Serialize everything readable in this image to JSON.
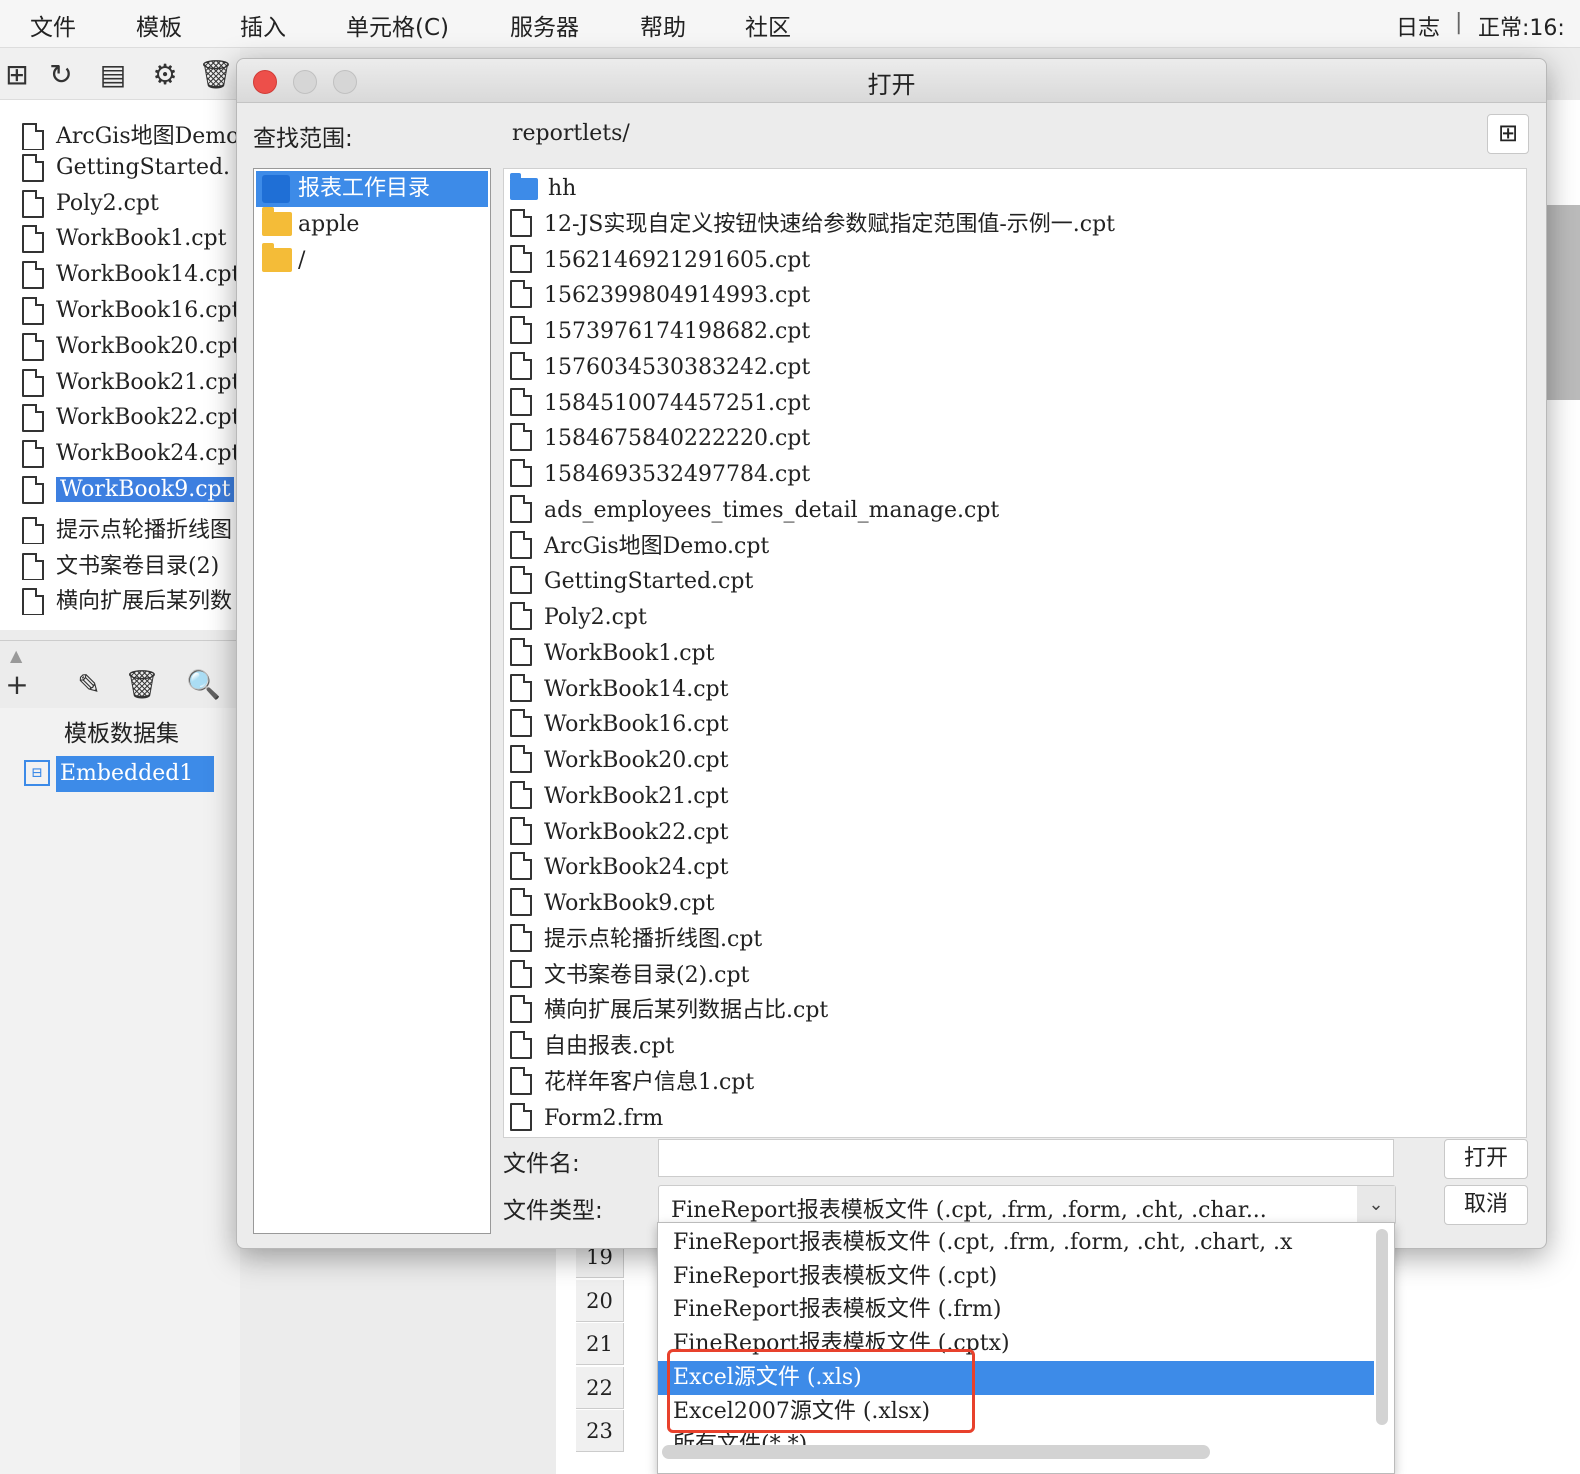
{
  "menubar": {
    "items": [
      "文件",
      "模板",
      "插入",
      "单元格(C)",
      "服务器",
      "帮助",
      "社区"
    ],
    "log_label": "日志",
    "separator": "|",
    "status_text": "正常:16:"
  },
  "left_tree": {
    "files": [
      "ArcGis地图Demo.",
      "GettingStarted.",
      "Poly2.cpt",
      "WorkBook1.cpt",
      "WorkBook14.cpt",
      "WorkBook16.cpt",
      "WorkBook20.cpt",
      "WorkBook21.cpt",
      "WorkBook22.cpt",
      "WorkBook24.cpt",
      "WorkBook9.cpt",
      "提示点轮播折线图",
      "文书案卷目录(2)",
      "横向扩展后某列数"
    ],
    "selected_index": 10
  },
  "dataset_panel": {
    "title": "模板数据集",
    "items": [
      "Embedded1"
    ]
  },
  "spreadsheet": {
    "row_numbers": [
      "19",
      "20",
      "21",
      "22",
      "23"
    ]
  },
  "dialog": {
    "title": "打开",
    "lookin_label": "查找范围:",
    "lookin_path": "reportlets/",
    "places": [
      "报表工作目录",
      "apple",
      "/"
    ],
    "selected_place": 0,
    "folders": [
      "hh"
    ],
    "files": [
      "12-JS实现自定义按钮快速给参数赋指定范围值-示例一.cpt",
      "1562146921291605.cpt",
      "1562399804914993.cpt",
      "1573976174198682.cpt",
      "1576034530383242.cpt",
      "1584510074457251.cpt",
      "1584675840222220.cpt",
      "1584693532497784.cpt",
      "ads_employees_times_detail_manage.cpt",
      "ArcGis地图Demo.cpt",
      "GettingStarted.cpt",
      "Poly2.cpt",
      "WorkBook1.cpt",
      "WorkBook14.cpt",
      "WorkBook16.cpt",
      "WorkBook20.cpt",
      "WorkBook21.cpt",
      "WorkBook22.cpt",
      "WorkBook24.cpt",
      "WorkBook9.cpt",
      "提示点轮播折线图.cpt",
      "文书案卷目录(2).cpt",
      "横向扩展后某列数据占比.cpt",
      "自由报表.cpt",
      "花样年客户信息1.cpt",
      "Form2.frm"
    ],
    "filename_label": "文件名:",
    "filename_value": "",
    "filetype_label": "文件类型:",
    "filetype_value": "FineReport报表模板文件 (.cpt, .frm, .form, .cht, .char...",
    "open_button": "打开",
    "cancel_button": "取消"
  },
  "filetype_dropdown": {
    "options": [
      "FineReport报表模板文件 (.cpt, .frm, .form, .cht, .chart, .x",
      "FineReport报表模板文件 (.cpt)",
      "FineReport报表模板文件 (.frm)",
      "FineReport报表模板文件 (.cptx)",
      "Excel源文件 (.xls)",
      "Excel2007源文件 (.xlsx)",
      "所有文件(*.*)"
    ],
    "selected_index": 4
  },
  "colors": {
    "selection_blue": "#3d8be8",
    "highlight_red": "#e8412c",
    "folder_yellow": "#f4bc38"
  }
}
